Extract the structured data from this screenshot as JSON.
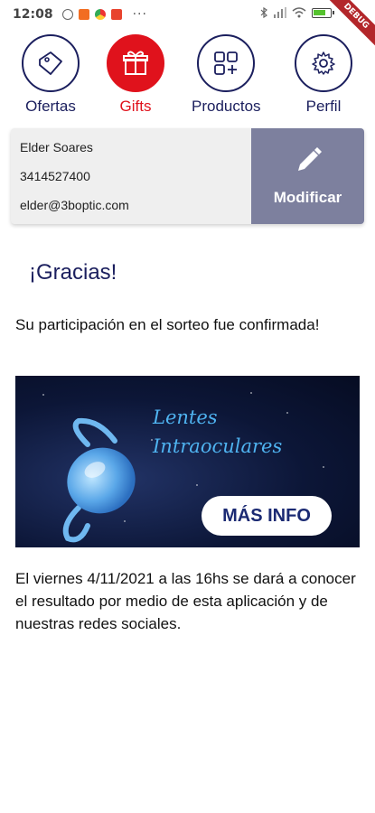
{
  "status": {
    "time": "12:08",
    "more": "···",
    "debug_label": "DEBUG"
  },
  "nav": {
    "items": [
      {
        "label": "Ofertas",
        "icon": "tag-icon",
        "active": false
      },
      {
        "label": "Gifts",
        "icon": "gift-icon",
        "active": true
      },
      {
        "label": "Productos",
        "icon": "grid-icon",
        "active": false
      },
      {
        "label": "Perfil",
        "icon": "gear-icon",
        "active": false
      }
    ],
    "colors": {
      "primary": "#1b1f5e",
      "active": "#e0121c"
    }
  },
  "profile": {
    "name": "Elder Soares",
    "phone": "3414527400",
    "email": "elder@3boptic.com",
    "edit_label": "Modificar"
  },
  "content": {
    "thanks": "¡Gracias!",
    "confirmation": "Su participación en el sorteo fue confirmada!",
    "banner": {
      "title_line1": "Lentes",
      "title_line2": "Intraoculares",
      "button_label": "MÁS INFO"
    },
    "result_text": "El viernes 4/11/2021 a las 16hs se dará a conocer el resultado por medio de esta aplicación y de nuestras redes sociales."
  }
}
